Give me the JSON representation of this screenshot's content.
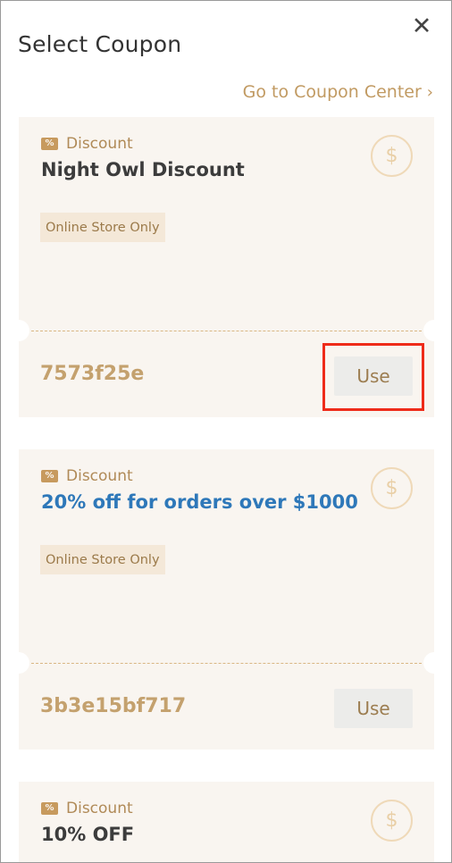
{
  "header": {
    "title": "Select Coupon",
    "close_icon": "close-icon",
    "coupon_center_link": "Go to Coupon Center",
    "chevron_icon": "chevron-right-icon"
  },
  "coupons": [
    {
      "type": "Discount",
      "name": "Night Owl Discount",
      "tag": "Online Store Only",
      "code": "7573f25e",
      "use_label": "Use"
    },
    {
      "type": "Discount",
      "name": "20% off for orders over $1000",
      "tag": "Online Store Only",
      "code": "3b3e15bf717",
      "use_label": "Use"
    },
    {
      "type": "Discount",
      "name": "10% OFF"
    }
  ],
  "colors": {
    "accent": "#c19a62",
    "card_bg": "#f9f5f0",
    "highlight": "#ee2b1a",
    "blue_title": "#2e78b9"
  }
}
